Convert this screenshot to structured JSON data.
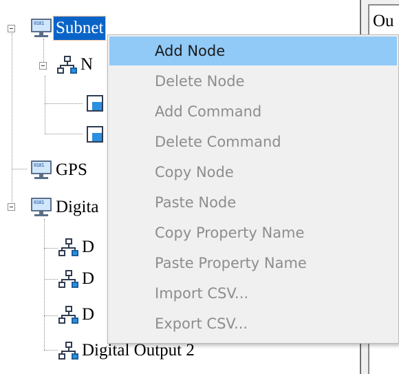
{
  "tree": {
    "nodes": [
      {
        "label": "Subnet",
        "icon": "monitor-icon",
        "selected": true
      },
      {
        "label": "N",
        "icon": "network-icon"
      },
      {
        "label": "",
        "icon": "command-icon"
      },
      {
        "label": "",
        "icon": "command-icon"
      },
      {
        "label": "GPS",
        "icon": "monitor-icon"
      },
      {
        "label": "Digita",
        "icon": "monitor-icon"
      },
      {
        "label": "D",
        "icon": "network-icon"
      },
      {
        "label": "D",
        "icon": "network-icon"
      },
      {
        "label": "D",
        "icon": "network-icon"
      },
      {
        "label": "Digital Output 2",
        "icon": "network-icon"
      }
    ],
    "screen_text": "0101"
  },
  "right_panel": {
    "text": "Ou"
  },
  "context_menu": {
    "items": [
      {
        "label": "Add Node",
        "enabled": true,
        "highlighted": true
      },
      {
        "label": "Delete Node",
        "enabled": false
      },
      {
        "label": "Add Command",
        "enabled": false
      },
      {
        "label": "Delete Command",
        "enabled": false
      },
      {
        "label": "Copy Node",
        "enabled": false
      },
      {
        "label": "Paste Node",
        "enabled": false
      },
      {
        "label": "Copy Property Name",
        "enabled": false
      },
      {
        "label": "Paste Property Name",
        "enabled": false
      },
      {
        "label": "Import CSV...",
        "enabled": false
      },
      {
        "label": "Export CSV...",
        "enabled": false
      }
    ]
  },
  "colors": {
    "selection": "#0a64c8",
    "menu_highlight": "#91c9f7",
    "menu_background": "#f0f0f0"
  }
}
